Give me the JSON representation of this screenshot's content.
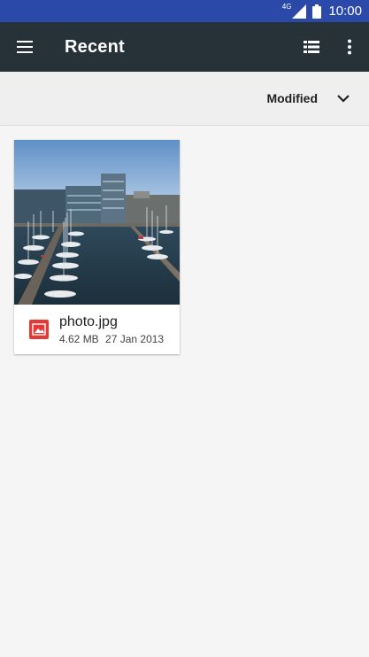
{
  "status_bar": {
    "network": "4G",
    "time": "10:00"
  },
  "toolbar": {
    "title": "Recent",
    "icons": [
      "menu-icon",
      "list-view-icon",
      "more-vert-icon"
    ]
  },
  "sort": {
    "label": "Modified",
    "icon": "chevron-down-icon"
  },
  "files": [
    {
      "name": "photo.jpg",
      "size": "4.62 MB",
      "date": "27 Jan 2013",
      "type_icon": "image-icon",
      "type_color": "#e53935"
    }
  ],
  "colors": {
    "status_bar": "#2b49a8",
    "toolbar": "#263238",
    "background": "#f5f5f5"
  }
}
